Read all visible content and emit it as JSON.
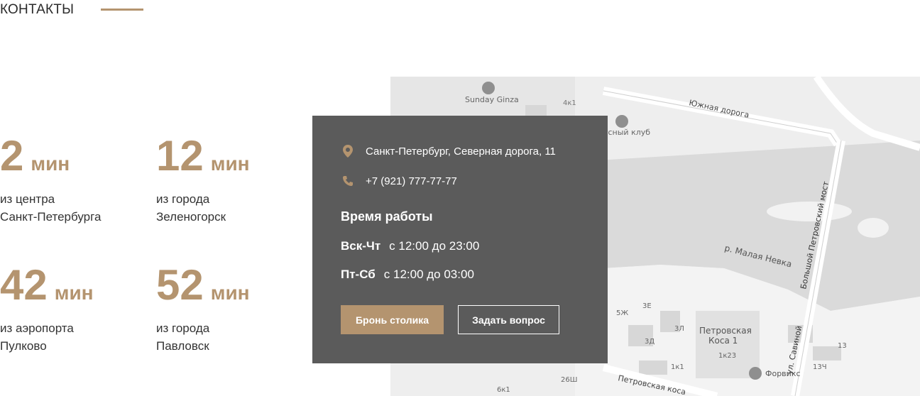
{
  "section": {
    "title": "КОНТАКТЫ"
  },
  "stats": [
    {
      "value": "2",
      "unit": "мин",
      "line1": "из центра",
      "line2": "Санкт-Петербурга"
    },
    {
      "value": "12",
      "unit": "мин",
      "line1": "из города",
      "line2": "Зеленогорск"
    },
    {
      "value": "42",
      "unit": "мин",
      "line1": "из аэропорта",
      "line2": "Пулково"
    },
    {
      "value": "52",
      "unit": "мин",
      "line1": "из города",
      "line2": "Павловск"
    }
  ],
  "contact": {
    "address": "Санкт-Петербург, Северная дорога, 11",
    "phone": "+7 (921) 777-77-77",
    "hours_title": "Время работы",
    "hours": [
      {
        "days": "Вск-Чт",
        "time": "с 12:00 до 23:00"
      },
      {
        "days": "Пт-Сб",
        "time": "с 12:00 до 03:00"
      }
    ],
    "book_label": "Бронь столика",
    "ask_label": "Задать вопрос"
  },
  "map": {
    "labels": {
      "sunday": "Sunday Ginza",
      "b4k1": "4к1",
      "road": "Южная дорога",
      "club": "усный клуб",
      "river": "р. Малая Невка",
      "bridge": "Большой Петровский мост",
      "savina": "ул. Савиной",
      "kosa": "Петровская",
      "kosa2": "Коса 1",
      "k23": "1к23",
      "b13": "13",
      "b13ch": "13Ч",
      "b5zh": "5Ж",
      "b3e": "3Е",
      "b3l": "3Л",
      "b3d": "3Д",
      "b1k1": "1к1",
      "b26sh": "26Ш",
      "b6k1": "6к1",
      "pkosa": "Петровская коса",
      "forvik": "Форвикс"
    }
  },
  "colors": {
    "accent": "#b4946f",
    "card": "#5b5b5b"
  }
}
